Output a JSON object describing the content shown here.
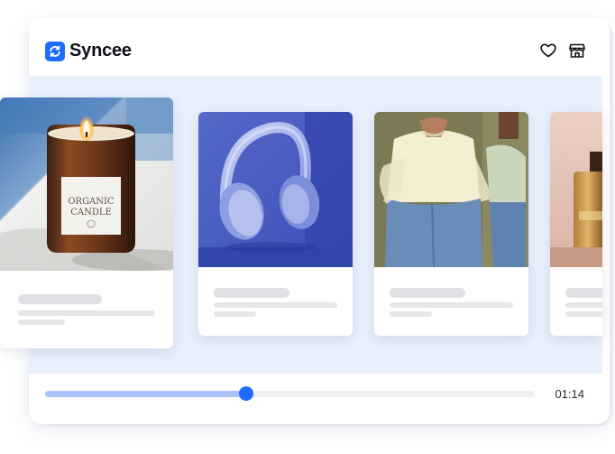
{
  "app": {
    "brand": "Syncee"
  },
  "header": {
    "icons": [
      "heart-icon",
      "store-icon"
    ]
  },
  "colors": {
    "accent": "#1f6bff",
    "stage_background": "#e8f0fc",
    "progress_fill": "#a9c2f7"
  },
  "products": [
    {
      "image": "candle-jar-photo",
      "label": "ORGANIC",
      "sublabel": "CANDLE"
    },
    {
      "image": "headphones-photo"
    },
    {
      "image": "blouse-jeans-photo"
    },
    {
      "image": "perfume-bottle-photo"
    }
  ],
  "player": {
    "time": "01:14",
    "progress": 0.41
  }
}
